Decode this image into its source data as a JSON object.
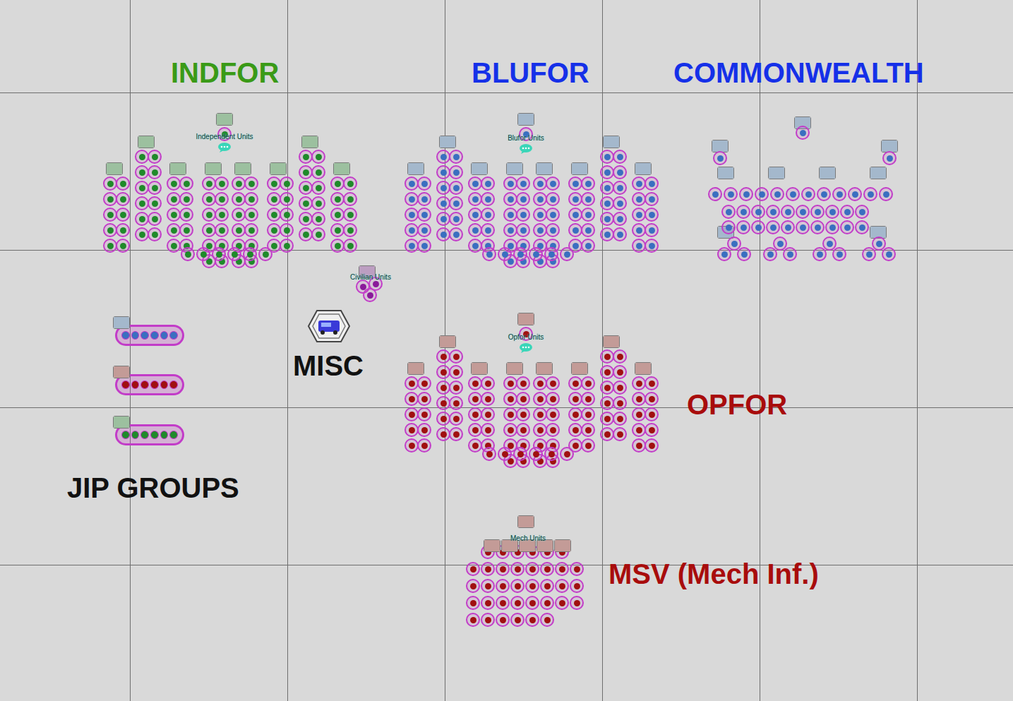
{
  "labels": [
    {
      "text": "INDFOR",
      "color": "#3a9a17"
    },
    {
      "text": "BLUFOR",
      "color": "#1530e8"
    },
    {
      "text": "COMMONWEALTH",
      "color": "#1530e8"
    },
    {
      "text": "MISC",
      "color": "#111111"
    },
    {
      "text": "OPFOR",
      "color": "#a80c0c"
    },
    {
      "text": "JIP GROUPS",
      "color": "#111111"
    },
    {
      "text": "MSV (Mech Inf.)",
      "color": "#a80c0c"
    }
  ],
  "formations": [
    {
      "name": "Independent Units",
      "color": "#1f8a2a"
    },
    {
      "name": "Blufor Units",
      "color": "#3a6fc0"
    },
    {
      "name": "Opfor Units",
      "color": "#a01010"
    },
    {
      "name": "Mech Units",
      "color": "#a01010"
    },
    {
      "name": "Civilian Units",
      "color": "#8a1a9a"
    }
  ],
  "commonwealth": {
    "color": "#3a6fc0"
  },
  "jip_groups": [
    {
      "color": "#3a6fc0"
    },
    {
      "color": "#a01010"
    },
    {
      "color": "#1f8a2a"
    }
  ]
}
